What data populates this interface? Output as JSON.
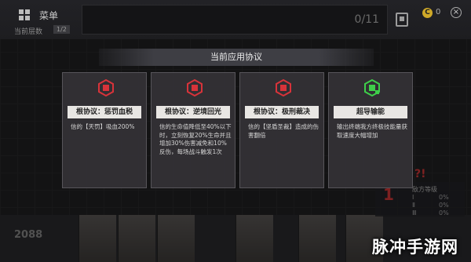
{
  "topbar": {
    "menu_label": "菜单",
    "sub_label": "当前层数",
    "sub_badge": "1/2",
    "counter": "0/11",
    "coin_symbol": "C",
    "coin_value": "0",
    "close_symbol": "×"
  },
  "protocols": {
    "title": "当前应用协议",
    "cards": [
      {
        "name": "根协议：惩罚血税",
        "desc": "信的【天罚】吸血200%",
        "icon": "red-cube-icon",
        "color": "#d8333a"
      },
      {
        "name": "根协议：逆境回光",
        "desc": "信的生命值降低至40%以下时，立刻恢复20%生命并且增加30%伤害减免和10%反伤，每场战斗触发1次",
        "icon": "red-cube-icon",
        "color": "#d8333a"
      },
      {
        "name": "根协议：极刑裁决",
        "desc": "信的【坚盾圣裁】造成的伤害翻倍",
        "icon": "red-cube-icon",
        "color": "#d8333a"
      },
      {
        "name": "超导输能",
        "desc": "输出终端我方终极技能量获取速度大幅增加",
        "icon": "green-chip-icon",
        "color": "#3ecf4a"
      }
    ]
  },
  "battle": {
    "score": "2088",
    "enemy_count": "1",
    "enemy_label": "敌方等级",
    "hazard": "?!",
    "rows": [
      {
        "label": "Ⅰ",
        "pct": "0%"
      },
      {
        "label": "Ⅱ",
        "pct": "0%"
      },
      {
        "label": "Ⅲ",
        "pct": "0%"
      }
    ]
  },
  "watermark": "脉冲手游网"
}
